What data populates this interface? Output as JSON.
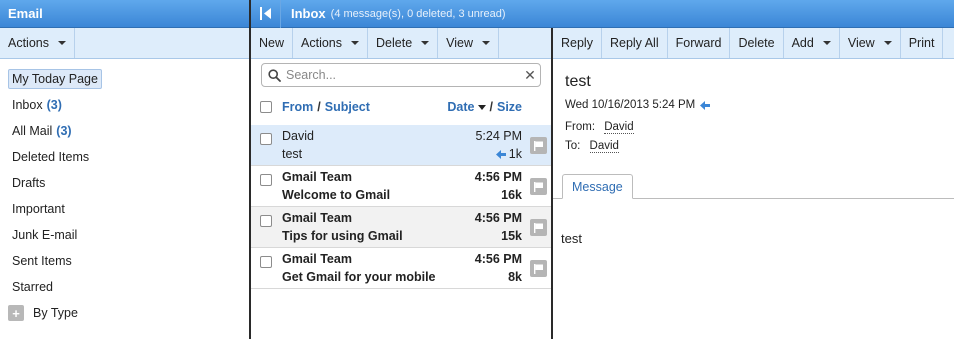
{
  "left_panel": {
    "title": "Email",
    "actions_label": "Actions",
    "folders": [
      {
        "label": "My Today Page",
        "count": ""
      },
      {
        "label": "Inbox",
        "count": "(3)"
      },
      {
        "label": "All Mail",
        "count": "(3)"
      },
      {
        "label": "Deleted Items",
        "count": ""
      },
      {
        "label": "Drafts",
        "count": ""
      },
      {
        "label": "Important",
        "count": ""
      },
      {
        "label": "Junk E-mail",
        "count": ""
      },
      {
        "label": "Sent Items",
        "count": ""
      },
      {
        "label": "Starred",
        "count": ""
      },
      {
        "label": "By Type",
        "count": ""
      }
    ]
  },
  "header": {
    "title": "Inbox",
    "subtitle": "(4 message(s), 0 deleted, 3 unread)"
  },
  "list_toolbar": {
    "new": "New",
    "actions": "Actions",
    "delete": "Delete",
    "view": "View"
  },
  "search": {
    "placeholder": "Search...",
    "value": ""
  },
  "list_header": {
    "from": "From",
    "sep1": "/",
    "subject": "Subject",
    "date": "Date",
    "sep2": "/",
    "size": "Size"
  },
  "messages": [
    {
      "from": "David",
      "subject": "test",
      "time": "5:24 PM",
      "size": "1k",
      "unread": false,
      "replied": true
    },
    {
      "from": "Gmail Team",
      "subject": "Welcome to Gmail",
      "time": "4:56 PM",
      "size": "16k",
      "unread": true,
      "replied": false
    },
    {
      "from": "Gmail Team",
      "subject": "Tips for using Gmail",
      "time": "4:56 PM",
      "size": "15k",
      "unread": true,
      "replied": false
    },
    {
      "from": "Gmail Team",
      "subject": "Get Gmail for your mobile",
      "time": "4:56 PM",
      "size": "8k",
      "unread": true,
      "replied": false
    }
  ],
  "reader_toolbar": {
    "reply": "Reply",
    "reply_all": "Reply All",
    "forward": "Forward",
    "delete": "Delete",
    "add": "Add",
    "view": "View",
    "print": "Print"
  },
  "reader": {
    "subject": "test",
    "date": "Wed 10/16/2013 5:24 PM",
    "from_label": "From:",
    "from": "David",
    "to_label": "To:",
    "to": "David",
    "tab": "Message",
    "body": "test"
  },
  "colors": {
    "accent": "#3b86d6",
    "toolbar_bg": "#deedfb",
    "link": "#2f6db3",
    "selected_row": "#ddebfa"
  }
}
